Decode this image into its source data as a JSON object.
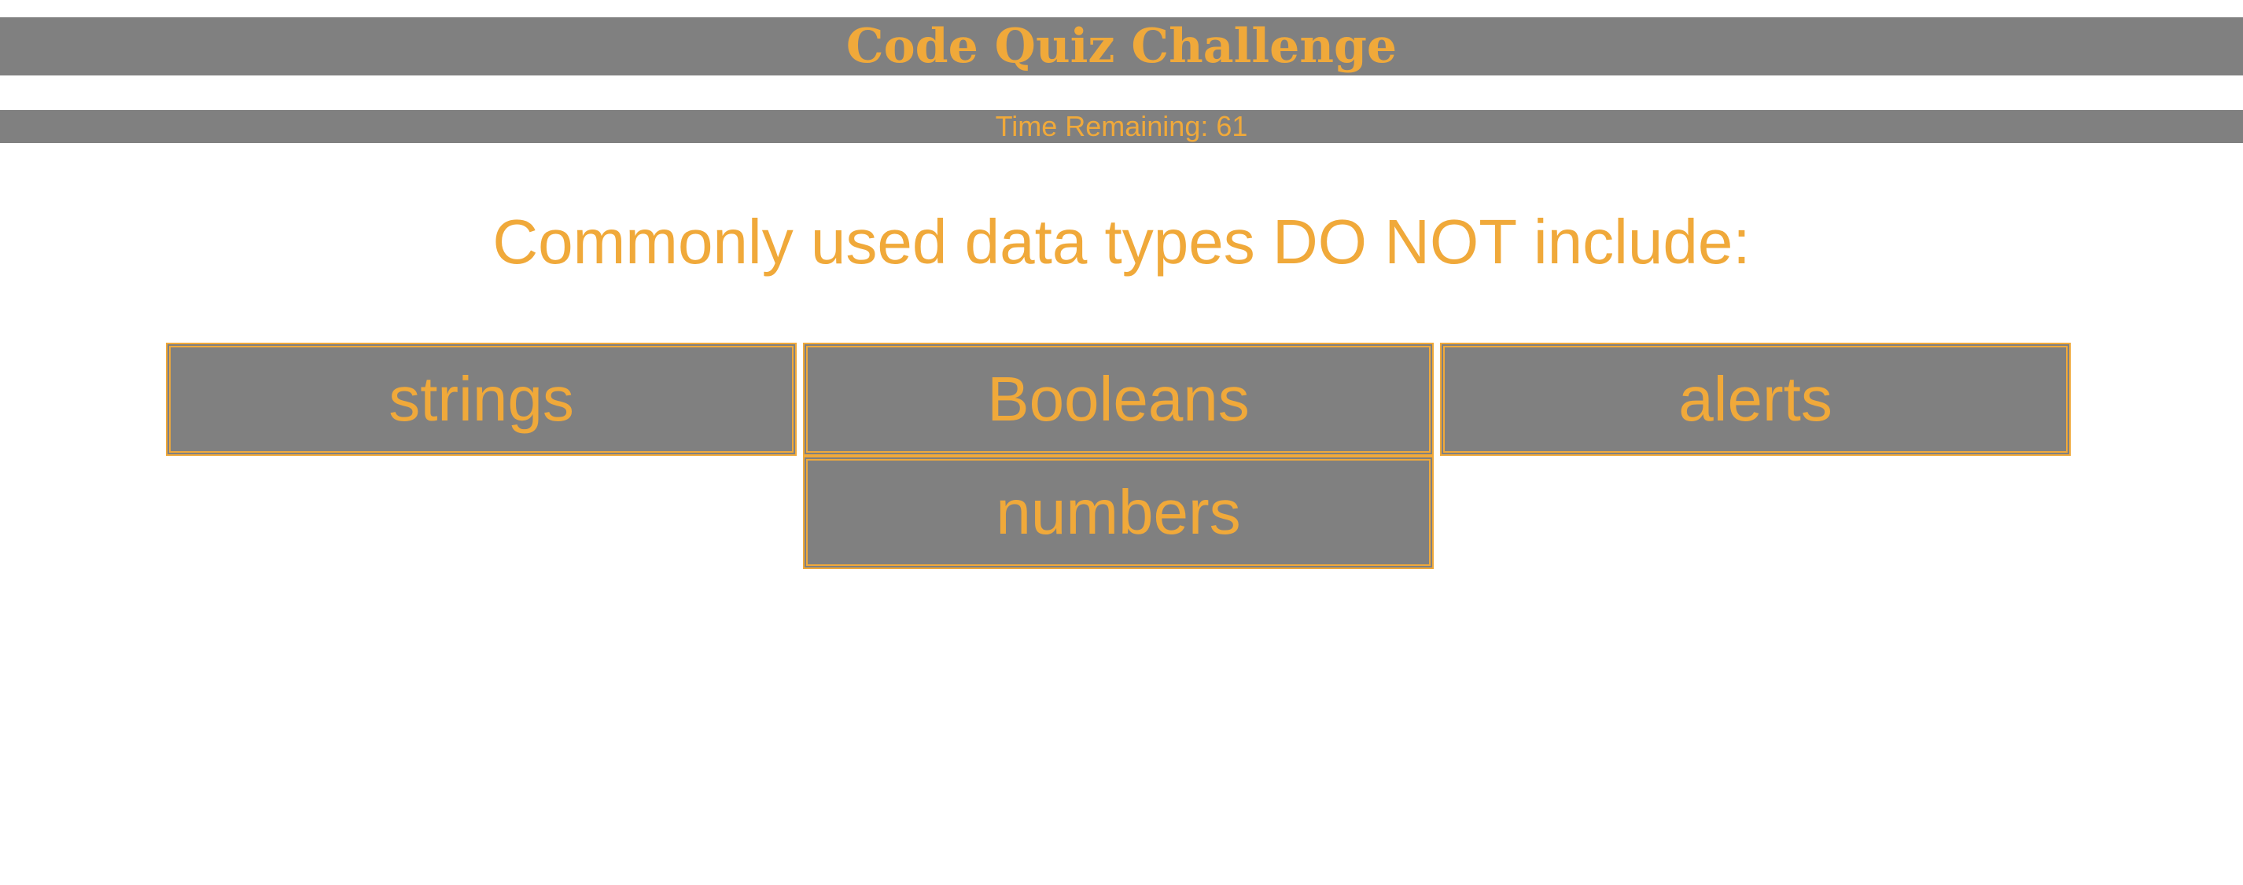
{
  "header": {
    "title": "Code Quiz Challenge"
  },
  "timer": {
    "label": "Time Remaining: 61"
  },
  "quiz": {
    "question": "Commonly used data types DO NOT include:",
    "choices": [
      {
        "label": "strings"
      },
      {
        "label": "Booleans"
      },
      {
        "label": "alerts"
      },
      {
        "label": "numbers"
      }
    ]
  },
  "colors": {
    "accent": "#f0a93a",
    "bar_background": "#808080",
    "page_background": "#ffffff"
  }
}
